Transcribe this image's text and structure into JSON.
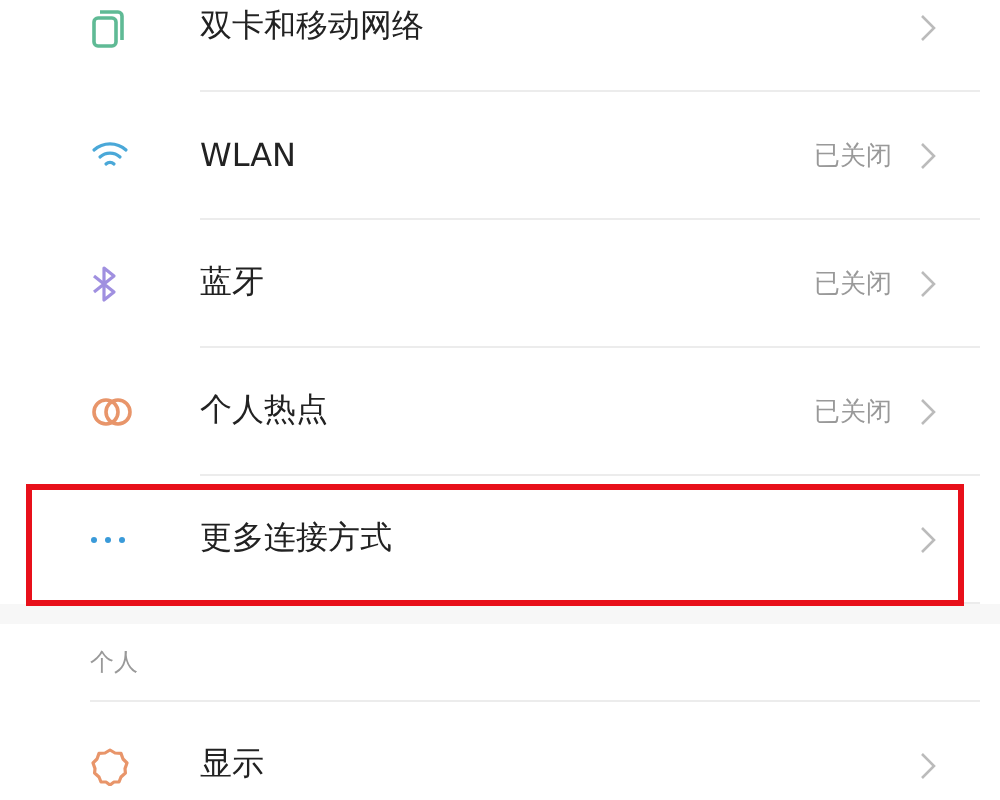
{
  "groups": [
    {
      "items": [
        {
          "label": "双卡和移动网络",
          "highlighted": false
        },
        {
          "label": "WLAN",
          "status": "已关闭",
          "highlighted": false
        },
        {
          "label": "蓝牙",
          "status": "已关闭",
          "highlighted": false
        },
        {
          "label": "个人热点",
          "status": "已关闭",
          "highlighted": false
        },
        {
          "label": "更多连接方式",
          "highlighted": true
        }
      ]
    },
    {
      "header": "个人",
      "items": [
        {
          "label": "显示",
          "highlighted": false
        }
      ]
    }
  ]
}
